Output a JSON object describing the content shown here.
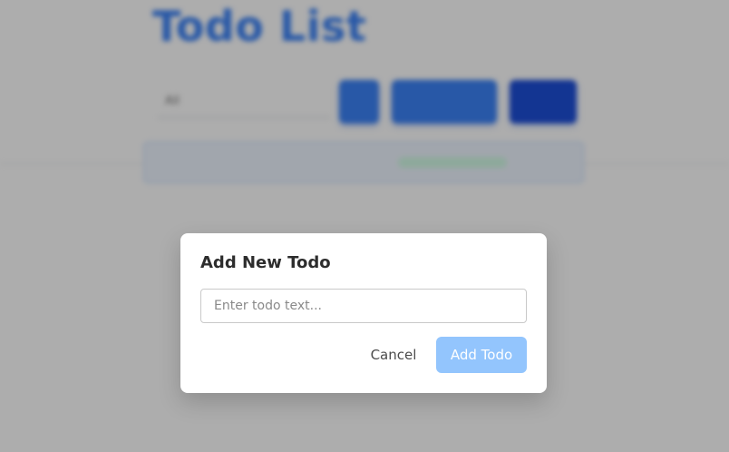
{
  "app": {
    "title": "Todo List",
    "toolbar": {
      "filter_placeholder": "All",
      "add_label": "+",
      "middle_label": "",
      "right_label": ""
    },
    "todo": {
      "text": "",
      "status": ""
    }
  },
  "modal": {
    "title": "Add New Todo",
    "input_placeholder": "Enter todo text...",
    "input_value": "",
    "cancel_label": "Cancel",
    "add_label": "Add Todo"
  },
  "colors": {
    "accent": "#3b82f6",
    "accent_disabled": "#93c5fd",
    "overlay": "rgba(0,0,0,0.32)"
  }
}
